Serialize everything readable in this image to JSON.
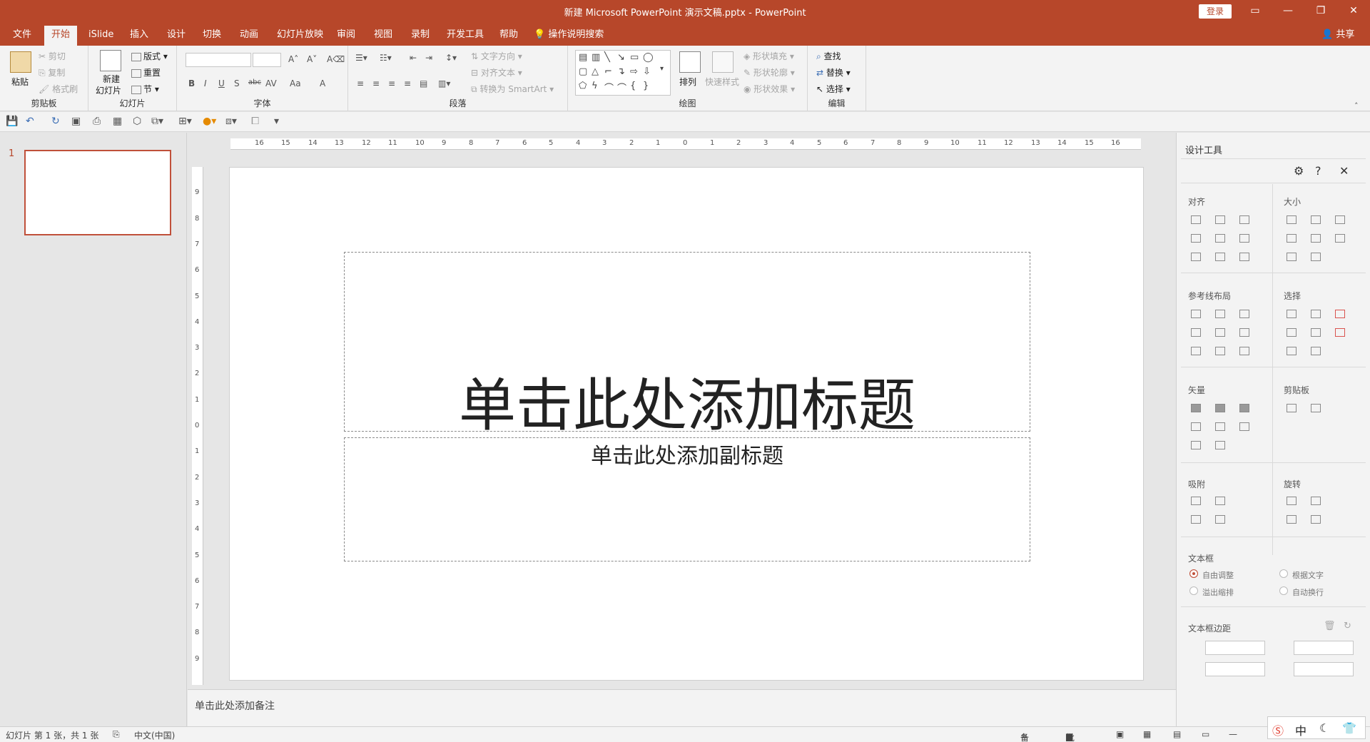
{
  "window": {
    "title": "新建 Microsoft PowerPoint 演示文稿.pptx - PowerPoint",
    "login_label": "登录",
    "minimize_icon": "minimize-icon",
    "restore_icon": "restore-icon",
    "close_icon": "close-icon"
  },
  "menu": {
    "tabs": [
      "文件",
      "开始",
      "iSlide",
      "插入",
      "设计",
      "切换",
      "动画",
      "幻灯片放映",
      "审阅",
      "视图",
      "录制",
      "开发工具",
      "帮助"
    ],
    "tell_me": "操作说明搜索",
    "share": "共享"
  },
  "ribbon": {
    "clipboard": {
      "label": "剪贴板",
      "paste": "粘贴",
      "cut": "剪切",
      "copy": "复制",
      "format_painter": "格式刷"
    },
    "slides": {
      "label": "幻灯片",
      "new_slide_line1": "新建",
      "new_slide_line2": "幻灯片",
      "layout": "版式",
      "reset": "重置",
      "section": "节"
    },
    "font": {
      "label": "字体",
      "bold": "B",
      "italic": "I",
      "underline": "U",
      "shadow": "S",
      "strike": "abc",
      "spacing": "AV",
      "case": "Aa",
      "color": "A"
    },
    "paragraph": {
      "label": "段落",
      "text_direction": "文字方向",
      "align_text": "对齐文本",
      "smartart": "转换为 SmartArt"
    },
    "drawing": {
      "label": "绘图",
      "arrange": "排列",
      "quick_styles": "快速样式",
      "shape_fill": "形状填充",
      "shape_outline": "形状轮廓",
      "shape_effects": "形状效果"
    },
    "editing": {
      "label": "编辑",
      "find": "查找",
      "replace": "替换",
      "select": "选择"
    }
  },
  "ruler": {
    "h_ticks": [
      "16",
      "15",
      "14",
      "13",
      "12",
      "11",
      "10",
      "9",
      "8",
      "7",
      "6",
      "5",
      "4",
      "3",
      "2",
      "1",
      "0",
      "1",
      "2",
      "3",
      "4",
      "5",
      "6",
      "7",
      "8",
      "9",
      "10",
      "11",
      "12",
      "13",
      "14",
      "15",
      "16"
    ],
    "v_ticks": [
      "9",
      "8",
      "7",
      "6",
      "5",
      "4",
      "3",
      "2",
      "1",
      "0",
      "1",
      "2",
      "3",
      "4",
      "5",
      "6",
      "7",
      "8",
      "9"
    ]
  },
  "thumbnails": {
    "slide_number": "1"
  },
  "slide": {
    "title_placeholder": "单击此处添加标题",
    "subtitle_placeholder": "单击此处添加副标题"
  },
  "notes": {
    "placeholder": "单击此处添加备注"
  },
  "design_panel": {
    "title": "设计工具",
    "sections": {
      "align": "对齐",
      "size": "大小",
      "guides": "参考线布局",
      "select": "选择",
      "vector": "矢量",
      "clipboard": "剪贴板",
      "snap": "吸附",
      "rotate": "旋转",
      "textbox": "文本框",
      "margins": "文本框边距"
    },
    "textbox_options": {
      "auto_adjust": "自由调整",
      "fit_text": "根据文字",
      "overflow": "溢出缩排",
      "auto_wrap": "自动换行"
    }
  },
  "status": {
    "slide_info": "幻灯片 第 1 张，共 1 张",
    "language": "中文(中国)",
    "notes": "备注",
    "comments": "批注"
  },
  "ime": {
    "mode": "中"
  },
  "colors": {
    "accent": "#b7472a",
    "ribbon_bg": "#f3f3f3",
    "selection_border": "#c0503a"
  }
}
